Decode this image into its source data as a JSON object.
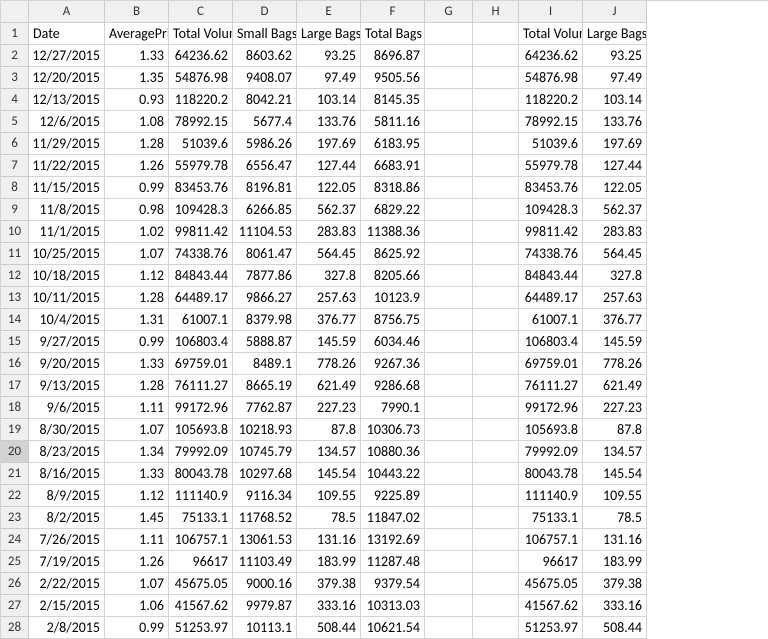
{
  "columns": [
    "A",
    "B",
    "C",
    "D",
    "E",
    "F",
    "G",
    "H",
    "I",
    "J"
  ],
  "headers": {
    "A": "Date",
    "B": "AveragePrice",
    "C": "Total Volume",
    "D": "Small Bags",
    "E": "Large Bags",
    "F": "Total Bags",
    "G": "",
    "H": "",
    "I": "Total Volume",
    "J": "Large Bags"
  },
  "rows": [
    {
      "n": "2",
      "A": "12/27/2015",
      "B": "1.33",
      "C": "64236.62",
      "D": "8603.62",
      "E": "93.25",
      "F": "8696.87",
      "G": "",
      "H": "",
      "I": "64236.62",
      "J": "93.25"
    },
    {
      "n": "3",
      "A": "12/20/2015",
      "B": "1.35",
      "C": "54876.98",
      "D": "9408.07",
      "E": "97.49",
      "F": "9505.56",
      "G": "",
      "H": "",
      "I": "54876.98",
      "J": "97.49"
    },
    {
      "n": "4",
      "A": "12/13/2015",
      "B": "0.93",
      "C": "118220.2",
      "D": "8042.21",
      "E": "103.14",
      "F": "8145.35",
      "G": "",
      "H": "",
      "I": "118220.2",
      "J": "103.14"
    },
    {
      "n": "5",
      "A": "12/6/2015",
      "B": "1.08",
      "C": "78992.15",
      "D": "5677.4",
      "E": "133.76",
      "F": "5811.16",
      "G": "",
      "H": "",
      "I": "78992.15",
      "J": "133.76"
    },
    {
      "n": "6",
      "A": "11/29/2015",
      "B": "1.28",
      "C": "51039.6",
      "D": "5986.26",
      "E": "197.69",
      "F": "6183.95",
      "G": "",
      "H": "",
      "I": "51039.6",
      "J": "197.69"
    },
    {
      "n": "7",
      "A": "11/22/2015",
      "B": "1.26",
      "C": "55979.78",
      "D": "6556.47",
      "E": "127.44",
      "F": "6683.91",
      "G": "",
      "H": "",
      "I": "55979.78",
      "J": "127.44"
    },
    {
      "n": "8",
      "A": "11/15/2015",
      "B": "0.99",
      "C": "83453.76",
      "D": "8196.81",
      "E": "122.05",
      "F": "8318.86",
      "G": "",
      "H": "",
      "I": "83453.76",
      "J": "122.05"
    },
    {
      "n": "9",
      "A": "11/8/2015",
      "B": "0.98",
      "C": "109428.3",
      "D": "6266.85",
      "E": "562.37",
      "F": "6829.22",
      "G": "",
      "H": "",
      "I": "109428.3",
      "J": "562.37"
    },
    {
      "n": "10",
      "A": "11/1/2015",
      "B": "1.02",
      "C": "99811.42",
      "D": "11104.53",
      "E": "283.83",
      "F": "11388.36",
      "G": "",
      "H": "",
      "I": "99811.42",
      "J": "283.83"
    },
    {
      "n": "11",
      "A": "10/25/2015",
      "B": "1.07",
      "C": "74338.76",
      "D": "8061.47",
      "E": "564.45",
      "F": "8625.92",
      "G": "",
      "H": "",
      "I": "74338.76",
      "J": "564.45"
    },
    {
      "n": "12",
      "A": "10/18/2015",
      "B": "1.12",
      "C": "84843.44",
      "D": "7877.86",
      "E": "327.8",
      "F": "8205.66",
      "G": "",
      "H": "",
      "I": "84843.44",
      "J": "327.8"
    },
    {
      "n": "13",
      "A": "10/11/2015",
      "B": "1.28",
      "C": "64489.17",
      "D": "9866.27",
      "E": "257.63",
      "F": "10123.9",
      "G": "",
      "H": "",
      "I": "64489.17",
      "J": "257.63"
    },
    {
      "n": "14",
      "A": "10/4/2015",
      "B": "1.31",
      "C": "61007.1",
      "D": "8379.98",
      "E": "376.77",
      "F": "8756.75",
      "G": "",
      "H": "",
      "I": "61007.1",
      "J": "376.77"
    },
    {
      "n": "15",
      "A": "9/27/2015",
      "B": "0.99",
      "C": "106803.4",
      "D": "5888.87",
      "E": "145.59",
      "F": "6034.46",
      "G": "",
      "H": "",
      "I": "106803.4",
      "J": "145.59"
    },
    {
      "n": "16",
      "A": "9/20/2015",
      "B": "1.33",
      "C": "69759.01",
      "D": "8489.1",
      "E": "778.26",
      "F": "9267.36",
      "G": "",
      "H": "",
      "I": "69759.01",
      "J": "778.26"
    },
    {
      "n": "17",
      "A": "9/13/2015",
      "B": "1.28",
      "C": "76111.27",
      "D": "8665.19",
      "E": "621.49",
      "F": "9286.68",
      "G": "",
      "H": "",
      "I": "76111.27",
      "J": "621.49"
    },
    {
      "n": "18",
      "A": "9/6/2015",
      "B": "1.11",
      "C": "99172.96",
      "D": "7762.87",
      "E": "227.23",
      "F": "7990.1",
      "G": "",
      "H": "",
      "I": "99172.96",
      "J": "227.23"
    },
    {
      "n": "19",
      "A": "8/30/2015",
      "B": "1.07",
      "C": "105693.8",
      "D": "10218.93",
      "E": "87.8",
      "F": "10306.73",
      "G": "",
      "H": "",
      "I": "105693.8",
      "J": "87.8"
    },
    {
      "n": "20",
      "A": "8/23/2015",
      "B": "1.34",
      "C": "79992.09",
      "D": "10745.79",
      "E": "134.57",
      "F": "10880.36",
      "G": "",
      "H": "",
      "I": "79992.09",
      "J": "134.57"
    },
    {
      "n": "21",
      "A": "8/16/2015",
      "B": "1.33",
      "C": "80043.78",
      "D": "10297.68",
      "E": "145.54",
      "F": "10443.22",
      "G": "",
      "H": "",
      "I": "80043.78",
      "J": "145.54"
    },
    {
      "n": "22",
      "A": "8/9/2015",
      "B": "1.12",
      "C": "111140.9",
      "D": "9116.34",
      "E": "109.55",
      "F": "9225.89",
      "G": "",
      "H": "",
      "I": "111140.9",
      "J": "109.55"
    },
    {
      "n": "23",
      "A": "8/2/2015",
      "B": "1.45",
      "C": "75133.1",
      "D": "11768.52",
      "E": "78.5",
      "F": "11847.02",
      "G": "",
      "H": "",
      "I": "75133.1",
      "J": "78.5"
    },
    {
      "n": "24",
      "A": "7/26/2015",
      "B": "1.11",
      "C": "106757.1",
      "D": "13061.53",
      "E": "131.16",
      "F": "13192.69",
      "G": "",
      "H": "",
      "I": "106757.1",
      "J": "131.16"
    },
    {
      "n": "25",
      "A": "7/19/2015",
      "B": "1.26",
      "C": "96617",
      "D": "11103.49",
      "E": "183.99",
      "F": "11287.48",
      "G": "",
      "H": "",
      "I": "96617",
      "J": "183.99"
    },
    {
      "n": "26",
      "A": "2/22/2015",
      "B": "1.07",
      "C": "45675.05",
      "D": "9000.16",
      "E": "379.38",
      "F": "9379.54",
      "G": "",
      "H": "",
      "I": "45675.05",
      "J": "379.38"
    },
    {
      "n": "27",
      "A": "2/15/2015",
      "B": "1.06",
      "C": "41567.62",
      "D": "9979.87",
      "E": "333.16",
      "F": "10313.03",
      "G": "",
      "H": "",
      "I": "41567.62",
      "J": "333.16"
    },
    {
      "n": "28",
      "A": "2/8/2015",
      "B": "0.99",
      "C": "51253.97",
      "D": "10113.1",
      "E": "508.44",
      "F": "10621.54",
      "G": "",
      "H": "",
      "I": "51253.97",
      "J": "508.44"
    }
  ],
  "selectedRow": "20"
}
